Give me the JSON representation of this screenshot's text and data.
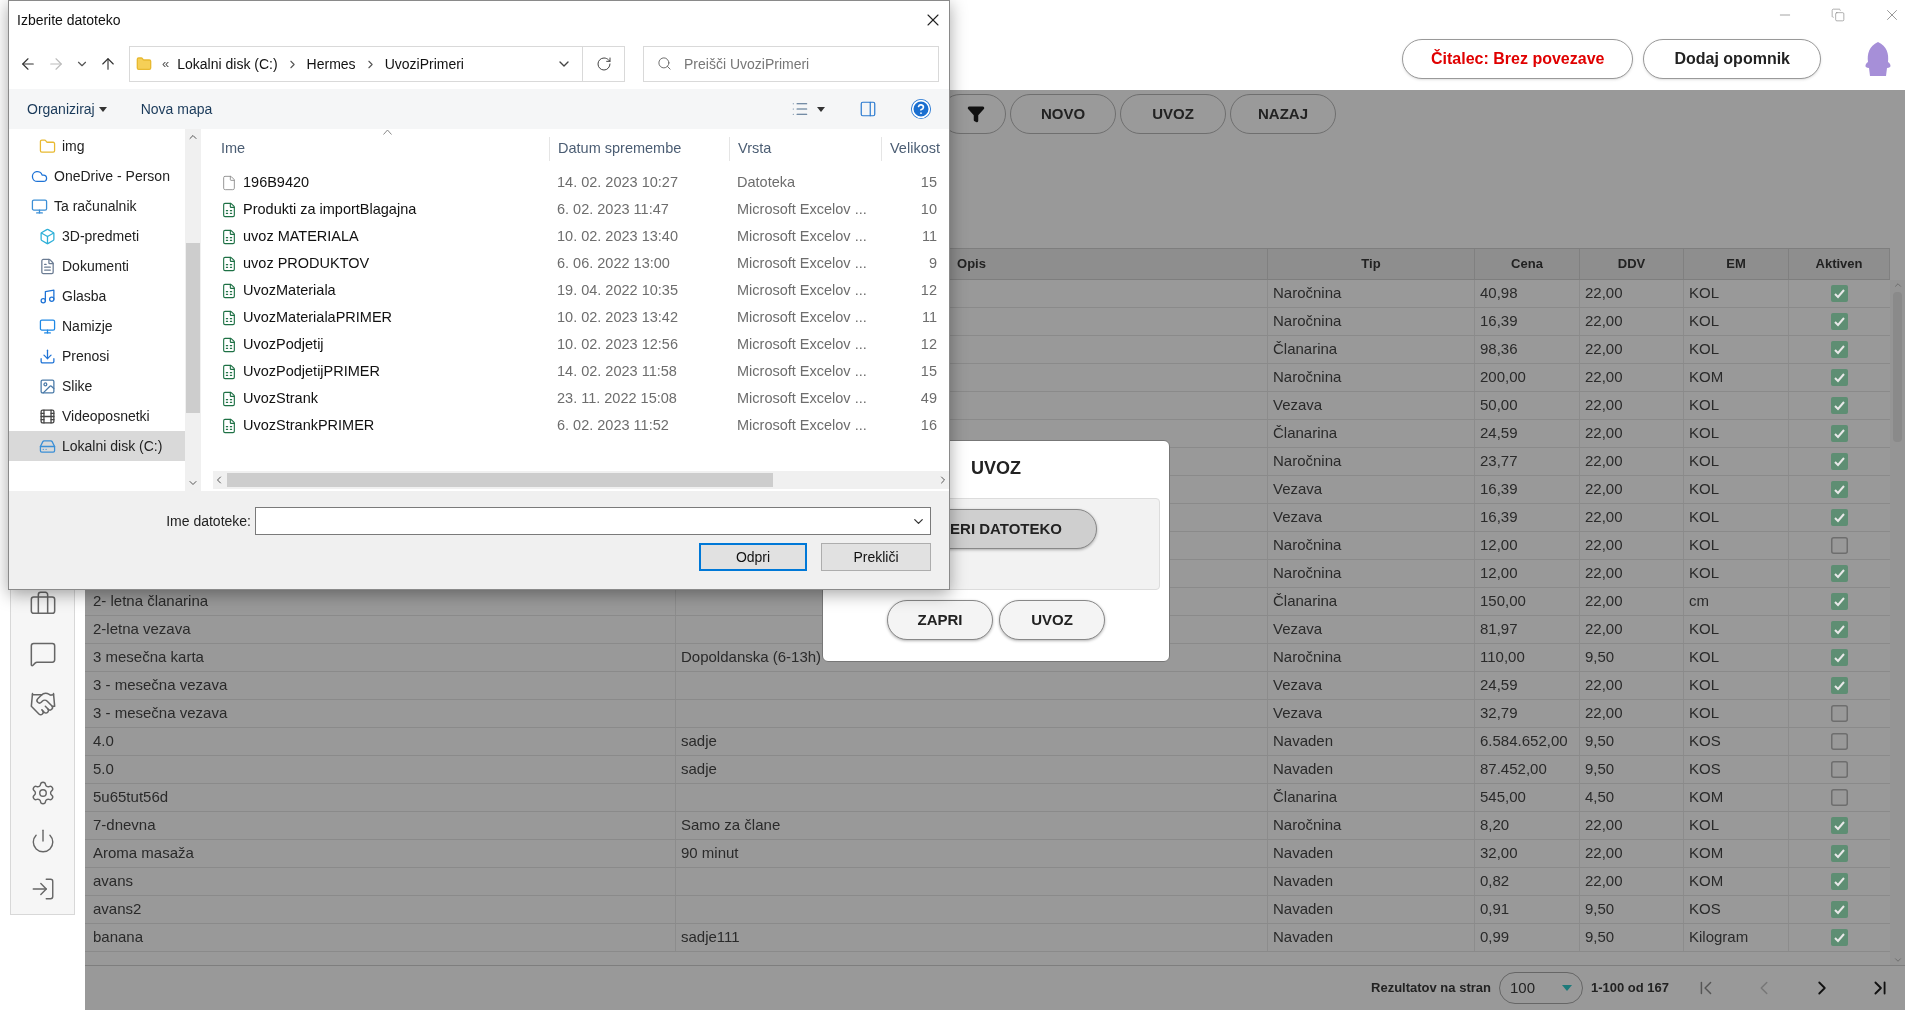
{
  "header": {
    "reader_button": "Čitalec: Brez povezave",
    "reminder_button": "Dodaj opomnik"
  },
  "toolbar": [
    "NOVO",
    "UVOZ",
    "NAZAJ"
  ],
  "table": {
    "columns": [
      "Opis",
      "Tip",
      "Cena",
      "DDV",
      "EM",
      "Aktiven"
    ],
    "rows": [
      {
        "type": "Naročnina",
        "price": "40,98",
        "vat": "22,00",
        "unit": "KOL",
        "active": true
      },
      {
        "type": "Naročnina",
        "price": "16,39",
        "vat": "22,00",
        "unit": "KOL",
        "active": true
      },
      {
        "type": "Članarina",
        "price": "98,36",
        "vat": "22,00",
        "unit": "KOL",
        "active": true
      },
      {
        "type": "Naročnina",
        "price": "200,00",
        "vat": "22,00",
        "unit": "KOM",
        "active": true
      },
      {
        "type": "Vezava",
        "price": "50,00",
        "vat": "22,00",
        "unit": "KOL",
        "active": true
      },
      {
        "type": "Članarina",
        "price": "24,59",
        "vat": "22,00",
        "unit": "KOL",
        "active": true
      },
      {
        "type": "Naročnina",
        "price": "23,77",
        "vat": "22,00",
        "unit": "KOL",
        "active": true
      },
      {
        "type": "Vezava",
        "price": "16,39",
        "vat": "22,00",
        "unit": "KOL",
        "active": true
      },
      {
        "type": "Vezava",
        "price": "16,39",
        "vat": "22,00",
        "unit": "KOL",
        "active": true
      },
      {
        "type": "Naročnina",
        "price": "12,00",
        "vat": "22,00",
        "unit": "KOL",
        "active": false
      },
      {
        "type": "Naročnina",
        "price": "12,00",
        "vat": "22,00",
        "unit": "KOL",
        "active": true
      },
      {
        "name": "2- letna članarina",
        "type": "Članarina",
        "price": "150,00",
        "vat": "22,00",
        "unit": "cm",
        "active": true
      },
      {
        "name": "2-letna vezava",
        "type": "Vezava",
        "price": "81,97",
        "vat": "22,00",
        "unit": "KOL",
        "active": true
      },
      {
        "name": "3 mesečna karta",
        "description": "Dopoldanska (6-13h)",
        "type": "Naročnina",
        "price": "110,00",
        "vat": "9,50",
        "unit": "KOL",
        "active": true
      },
      {
        "name": "3 - mesečna vezava",
        "type": "Vezava",
        "price": "24,59",
        "vat": "22,00",
        "unit": "KOL",
        "active": true
      },
      {
        "name": "3 - mesečna vezava",
        "type": "Vezava",
        "price": "32,79",
        "vat": "22,00",
        "unit": "KOL",
        "active": false
      },
      {
        "name": "4.0",
        "description": "sadje",
        "type": "Navaden",
        "price": "6.584.652,00",
        "vat": "9,50",
        "unit": "KOS",
        "active": false
      },
      {
        "name": "5.0",
        "description": "sadje",
        "type": "Navaden",
        "price": "87.452,00",
        "vat": "9,50",
        "unit": "KOS",
        "active": false
      },
      {
        "name": "5u65tut56d",
        "type": "Članarina",
        "price": "545,00",
        "vat": "4,50",
        "unit": "KOM",
        "active": false
      },
      {
        "name": "7-dnevna",
        "description": "Samo za člane",
        "type": "Naročnina",
        "price": "8,20",
        "vat": "22,00",
        "unit": "KOL",
        "active": true
      },
      {
        "name": "Aroma masaža",
        "description": "90 minut",
        "type": "Navaden",
        "price": "32,00",
        "vat": "22,00",
        "unit": "KOM",
        "active": true
      },
      {
        "name": "avans",
        "type": "Navaden",
        "price": "0,82",
        "vat": "22,00",
        "unit": "KOM",
        "active": true
      },
      {
        "name": "avans2",
        "type": "Navaden",
        "price": "0,91",
        "vat": "9,50",
        "unit": "KOS",
        "active": true
      },
      {
        "name": "banana",
        "description": "sadje111",
        "type": "Navaden",
        "price": "0,99",
        "vat": "9,50",
        "unit": "Kilogram",
        "active": true
      }
    ]
  },
  "pagination": {
    "label": "Rezultatov na stran",
    "page_size": "100",
    "range": "1-100 od 167"
  },
  "import_modal": {
    "title": "UVOZ",
    "choose_button": "ERI DATOTEKO",
    "buttons": [
      "ZAPRI",
      "UVOZ"
    ]
  },
  "file_dialog": {
    "title": "Izberite datoteko",
    "path_prefix": "«",
    "path": [
      "Lokalni disk (C:)",
      "Hermes",
      "UvoziPrimeri"
    ],
    "search": {
      "placeholder": "Preišči UvoziPrimeri"
    },
    "toolbar": [
      "Organiziraj",
      "Nova mapa"
    ],
    "nav": [
      {
        "label": "img",
        "kind": "folder",
        "selected": false
      },
      {
        "label": "OneDrive - Person",
        "kind": "cloud",
        "selected": false
      },
      {
        "label": "Ta računalnik",
        "kind": "computer",
        "selected": false,
        "children": [
          {
            "label": "3D-predmeti",
            "kind": "cube",
            "selected": false
          },
          {
            "label": "Dokumenti",
            "kind": "document",
            "selected": false
          },
          {
            "label": "Glasba",
            "kind": "music",
            "selected": false
          },
          {
            "label": "Namizje",
            "kind": "desktop",
            "selected": false
          },
          {
            "label": "Prenosi",
            "kind": "download",
            "selected": false
          },
          {
            "label": "Slike",
            "kind": "image",
            "selected": false
          },
          {
            "label": "Videoposnetki",
            "kind": "video",
            "selected": false
          },
          {
            "label": "Lokalni disk (C:)",
            "kind": "drive",
            "selected": true
          }
        ]
      }
    ],
    "columns": [
      "Ime",
      "Datum spremembe",
      "Vrsta",
      "Velikost"
    ],
    "files": [
      {
        "name": "196B9420",
        "date": "14. 02. 2023 10:27",
        "type": "Datoteka",
        "size": "15",
        "kind": "file"
      },
      {
        "name": "Produkti za importBlagajna",
        "date": "6. 02. 2023 11:47",
        "type": "Microsoft Excelov ...",
        "size": "10",
        "kind": "excel"
      },
      {
        "name": "uvoz MATERIALA",
        "date": "10. 02. 2023 13:40",
        "type": "Microsoft Excelov ...",
        "size": "11",
        "kind": "excel"
      },
      {
        "name": "uvoz PRODUKTOV",
        "date": "6. 06. 2022 13:00",
        "type": "Microsoft Excelov ...",
        "size": "9",
        "kind": "excel"
      },
      {
        "name": "UvozMateriala",
        "date": "19. 04. 2022 10:35",
        "type": "Microsoft Excelov ...",
        "size": "12",
        "kind": "excel"
      },
      {
        "name": "UvozMaterialaPRIMER",
        "date": "10. 02. 2023 13:42",
        "type": "Microsoft Excelov ...",
        "size": "11",
        "kind": "excel"
      },
      {
        "name": "UvozPodjetij",
        "date": "10. 02. 2023 12:56",
        "type": "Microsoft Excelov ...",
        "size": "12",
        "kind": "excel"
      },
      {
        "name": "UvozPodjetijPRIMER",
        "date": "14. 02. 2023 11:58",
        "type": "Microsoft Excelov ...",
        "size": "15",
        "kind": "excel"
      },
      {
        "name": "UvozStrank",
        "date": "23. 11. 2022 15:08",
        "type": "Microsoft Excelov ...",
        "size": "49",
        "kind": "excel"
      },
      {
        "name": "UvozStrankPRIMER",
        "date": "6. 02. 2023 11:52",
        "type": "Microsoft Excelov ...",
        "size": "16",
        "kind": "excel"
      }
    ],
    "filename": {
      "label": "Ime datoteke:"
    },
    "buttons": [
      "Odpri",
      "Prekliči"
    ]
  }
}
